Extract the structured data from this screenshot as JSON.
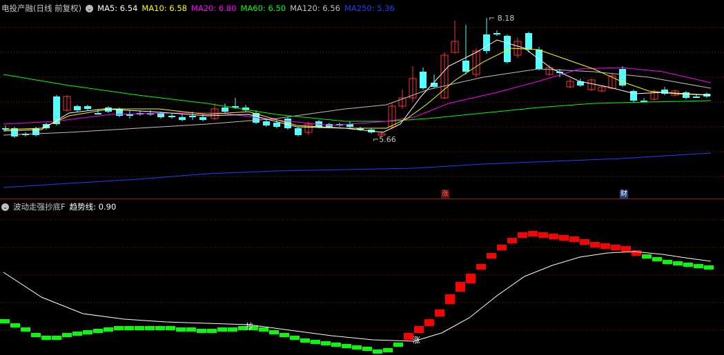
{
  "main": {
    "title": "电投产融(日线 前复权)",
    "ma": [
      {
        "label": "MA5: 6.54",
        "color": "#ffffff"
      },
      {
        "label": "MA10: 6.58",
        "color": "#ffff00"
      },
      {
        "label": "MA20: 6.80",
        "color": "#ff00ff"
      },
      {
        "label": "MA60: 6.50",
        "color": "#00ff00"
      },
      {
        "label": "MA120: 6.56",
        "color": "#c0c0c0"
      },
      {
        "label": "MA250: 5.36",
        "color": "#0000ff"
      }
    ],
    "high_label": "8.18",
    "low_label": "5.66",
    "events": [
      {
        "label": "涨",
        "color": "#d04040"
      },
      {
        "label": "财",
        "color": "#3050a0"
      }
    ]
  },
  "indicator": {
    "title": "波动走强抄底F",
    "trend_label": "趋势线: 0.90",
    "signal_buy": "抄",
    "signal_rise": "涨"
  },
  "colors": {
    "up": "#ff3232",
    "down": "#54ffff",
    "ind_up": "#ff0000",
    "ind_down": "#00ff00",
    "grid": "#8b1a1a"
  }
}
